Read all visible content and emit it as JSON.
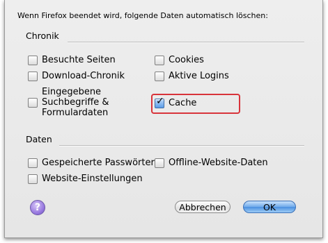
{
  "dialog": {
    "intro": "Wenn Firefox beendet wird, folgende Daten automatisch löschen:"
  },
  "history": {
    "title": "Chronik",
    "items": [
      {
        "label": "Besuchte Seiten",
        "checked": false
      },
      {
        "label": "Download-Chronik",
        "checked": false
      },
      {
        "label_lines": [
          "Eingegebene",
          "Suchbegriffe &",
          "Formulardaten"
        ],
        "checked": false
      },
      {
        "label": "Cookies",
        "checked": false
      },
      {
        "label": "Aktive Logins",
        "checked": false
      },
      {
        "label": "Cache",
        "checked": true
      }
    ]
  },
  "data": {
    "title": "Daten",
    "items": [
      {
        "label": "Gespeicherte Passwörter",
        "checked": false
      },
      {
        "label": "Website-Einstellungen",
        "checked": false
      },
      {
        "label": "Offline-Website-Daten",
        "checked": false
      }
    ]
  },
  "buttons": {
    "help": "?",
    "cancel": "Abbrechen",
    "ok": "OK"
  },
  "colors": {
    "highlight": "#d8333a",
    "ok_button": "#4a8fe0"
  }
}
